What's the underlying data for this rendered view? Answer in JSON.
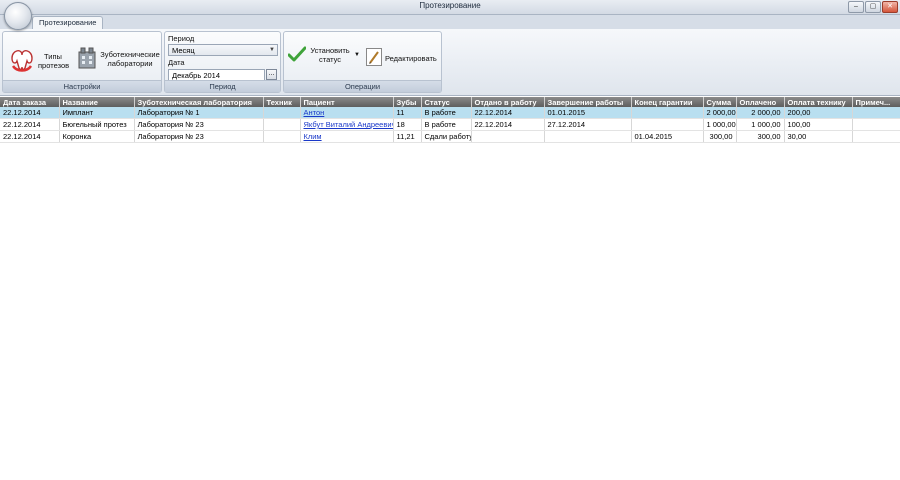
{
  "window": {
    "title": "Протезирование"
  },
  "window_buttons": [
    "–",
    "▢",
    "✕"
  ],
  "ribbon": {
    "tab": "Протезирование",
    "groups": {
      "settings": {
        "caption": "Настройки",
        "prosthesis_types": "Типы протезов",
        "labs": "Зуботехнические лаборатории"
      },
      "period": {
        "caption": "Период",
        "period_label": "Период",
        "period_value": "Месяц",
        "date_label": "Дата",
        "date_value": "Декабрь 2014",
        "browse": "..."
      },
      "operations": {
        "caption": "Операции",
        "set_status": "Установить статус",
        "edit": "Редактировать"
      }
    }
  },
  "table": {
    "columns": [
      "Дата заказа",
      "Название",
      "Зуботехническая лаборатория",
      "Техник",
      "Пациент",
      "Зубы",
      "Статус",
      "Отдано в работу",
      "Завершение работы",
      "Конец гарантии",
      "Сумма",
      "Оплачено",
      "Оплата технику",
      "Примеч..."
    ],
    "rows": [
      [
        "22.12.2014",
        "Имплант",
        "Лаборатория № 1",
        "",
        "Антон",
        "11",
        "В работе",
        "22.12.2014",
        "01.01.2015",
        "",
        "2 000,00",
        "2 000,00",
        "200,00",
        ""
      ],
      [
        "22.12.2014",
        "Бюгельный протез",
        "Лаборатория № 23",
        "",
        "Якбут Виталий Андреевич",
        "18",
        "В работе",
        "22.12.2014",
        "27.12.2014",
        "",
        "1 000,00",
        "1 000,00",
        "100,00",
        ""
      ],
      [
        "22.12.2014",
        "Коронка",
        "Лаборатория № 23",
        "",
        "Клим",
        "11,21",
        "Сдали работу",
        "",
        "",
        "01.04.2015",
        "300,00",
        "300,00",
        "30,00",
        ""
      ]
    ]
  },
  "colors": {
    "selected_row": "#b9dff0",
    "header_bg": "#6e6e6e",
    "link": "#1a39c9"
  }
}
